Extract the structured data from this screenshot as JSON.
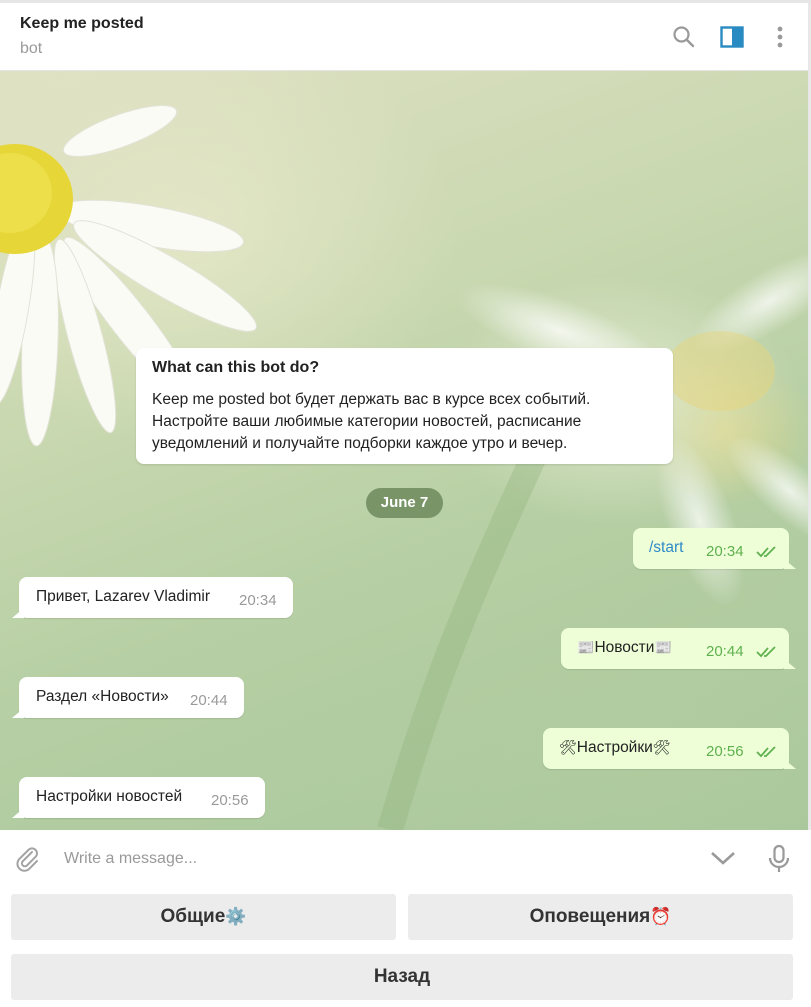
{
  "header": {
    "title": "Keep me posted",
    "subtitle": "bot",
    "icons": [
      "search-icon",
      "sidebar-toggle-icon",
      "more-icon"
    ],
    "accent_color": "#2a8ac2"
  },
  "info_card": {
    "title": "What can this bot do?",
    "body": "Keep me posted bot будет держать вас в курсе всех событий. Настройте ваши любимые категории новостей, расписание уведомлений и получайте подборки каждое утро и вечер."
  },
  "date_separator": "June 7",
  "messages": [
    {
      "direction": "out",
      "text": "/start",
      "time": "20:34",
      "status": "read"
    },
    {
      "direction": "in",
      "text": "Привет, Lazarev Vladimir",
      "time": "20:34"
    },
    {
      "direction": "out",
      "emoji": "📰",
      "text": "Новости",
      "emoji_end": "📰",
      "time": "20:44",
      "status": "read"
    },
    {
      "direction": "in",
      "text": "Раздел «Новости»",
      "time": "20:44"
    },
    {
      "direction": "out",
      "emoji": "🛠",
      "text": "Настройки",
      "emoji_end": "🛠",
      "time": "20:56",
      "status": "read"
    },
    {
      "direction": "in",
      "text": "Настройки новостей",
      "time": "20:56"
    }
  ],
  "composer": {
    "placeholder": "Write a message...",
    "icons": [
      "attach-icon",
      "keyboard-toggle-icon",
      "microphone-icon"
    ]
  },
  "keyboard": {
    "buttons": [
      {
        "label": "Общие",
        "emoji": "⚙️"
      },
      {
        "label": "Оповещения",
        "emoji": "⏰"
      },
      {
        "label": "Назад"
      }
    ]
  },
  "colors": {
    "incoming_bubble": "#ffffff",
    "outgoing_bubble": "#eefed7",
    "outgoing_time": "#5fb14f",
    "command_link": "#2f8bc8",
    "date_pill": "#708c5f"
  }
}
